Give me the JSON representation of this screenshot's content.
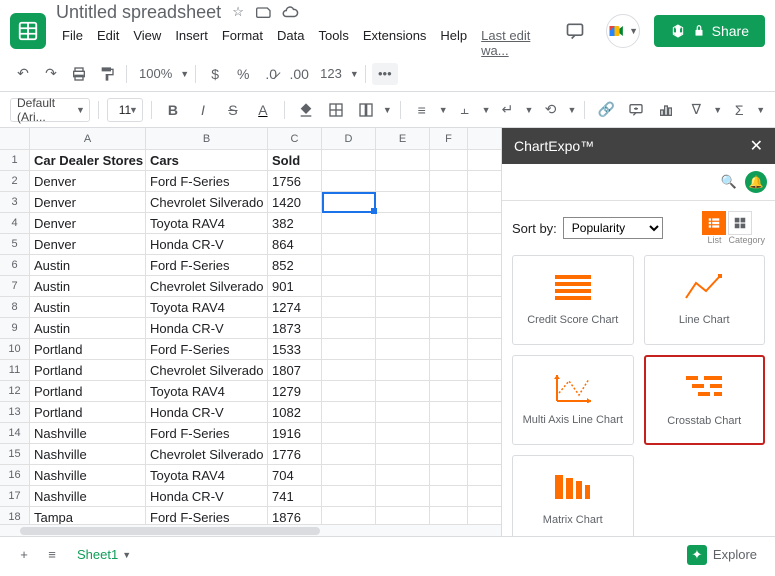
{
  "header": {
    "title": "Untitled spreadsheet",
    "last_edit": "Last edit wa...",
    "share": "Share"
  },
  "menu": [
    "File",
    "Edit",
    "View",
    "Insert",
    "Format",
    "Data",
    "Tools",
    "Extensions",
    "Help"
  ],
  "toolbar": {
    "zoom": "100%",
    "num_fmt": "123",
    "font": "Default (Ari...",
    "size": "11"
  },
  "columns": {
    "A": 116,
    "B": 122,
    "C": 54,
    "D": 54,
    "E": 54,
    "F": 38
  },
  "table": {
    "headers": [
      "Car Dealer Stores",
      "Cars",
      "Sold"
    ],
    "rows": [
      [
        "Denver",
        "Ford F-Series",
        "1756"
      ],
      [
        "Denver",
        "Chevrolet Silverado",
        "1420"
      ],
      [
        "Denver",
        "Toyota RAV4",
        "382"
      ],
      [
        "Denver",
        "Honda CR-V",
        "864"
      ],
      [
        "Austin",
        "Ford F-Series",
        "852"
      ],
      [
        "Austin",
        "Chevrolet Silverado",
        "901"
      ],
      [
        "Austin",
        "Toyota RAV4",
        "1274"
      ],
      [
        "Austin",
        "Honda CR-V",
        "1873"
      ],
      [
        "Portland",
        "Ford F-Series",
        "1533"
      ],
      [
        "Portland",
        "Chevrolet Silverado",
        "1807"
      ],
      [
        "Portland",
        "Toyota RAV4",
        "1279"
      ],
      [
        "Portland",
        "Honda CR-V",
        "1082"
      ],
      [
        "Nashville",
        "Ford F-Series",
        "1916"
      ],
      [
        "Nashville",
        "Chevrolet Silverado",
        "1776"
      ],
      [
        "Nashville",
        "Toyota RAV4",
        "704"
      ],
      [
        "Nashville",
        "Honda CR-V",
        "741"
      ],
      [
        "Tampa",
        "Ford F-Series",
        "1876"
      ]
    ]
  },
  "sidebar": {
    "title": "ChartExpo™",
    "sort_label": "Sort by:",
    "sort_value": "Popularity",
    "view_list": "List",
    "view_cat": "Category",
    "charts": [
      "Credit Score Chart",
      "Line Chart",
      "Multi Axis Line Chart",
      "Crosstab Chart",
      "Matrix Chart"
    ]
  },
  "footer": {
    "sheet": "Sheet1",
    "explore": "Explore"
  }
}
